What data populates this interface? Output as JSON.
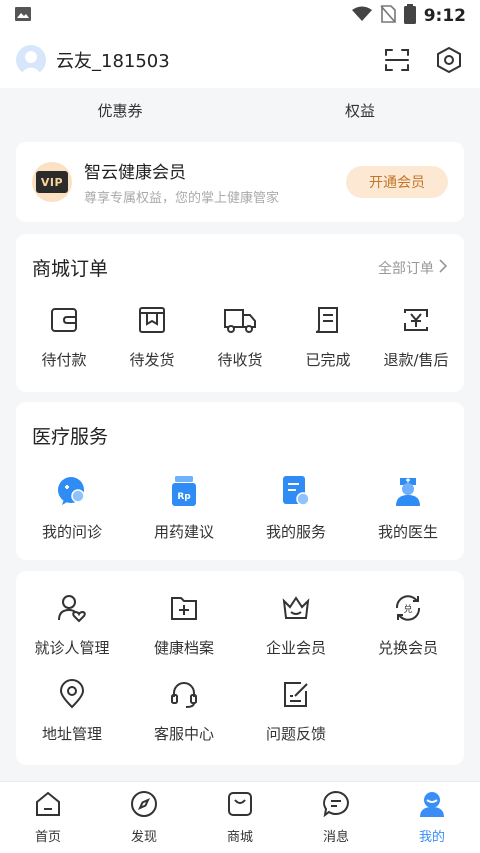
{
  "status_bar": {
    "time": "9:12"
  },
  "header": {
    "username": "云友_181503"
  },
  "coupon_row": {
    "coupon": "优惠券",
    "rights": "权益"
  },
  "vip": {
    "badge_text": "VIP",
    "title": "智云健康会员",
    "subtitle": "尊享专属权益，您的掌上健康管家",
    "button": "开通会员"
  },
  "orders": {
    "title": "商城订单",
    "all_link": "全部订单",
    "items": [
      {
        "label": "待付款",
        "icon": "wallet-icon"
      },
      {
        "label": "待发货",
        "icon": "package-icon"
      },
      {
        "label": "待收货",
        "icon": "truck-icon"
      },
      {
        "label": "已完成",
        "icon": "receipt-icon"
      },
      {
        "label": "退款/售后",
        "icon": "refund-icon"
      }
    ]
  },
  "medical": {
    "title": "医疗服务",
    "items": [
      {
        "label": "我的问诊",
        "icon": "chat-bubble-icon"
      },
      {
        "label": "用药建议",
        "icon": "medicine-bottle-icon"
      },
      {
        "label": "我的服务",
        "icon": "service-document-icon"
      },
      {
        "label": "我的医生",
        "icon": "nurse-icon"
      }
    ]
  },
  "more": {
    "items": [
      {
        "label": "就诊人管理",
        "icon": "patient-icon"
      },
      {
        "label": "健康档案",
        "icon": "folder-plus-icon"
      },
      {
        "label": "企业会员",
        "icon": "crown-icon"
      },
      {
        "label": "兑换会员",
        "icon": "exchange-icon"
      },
      {
        "label": "地址管理",
        "icon": "location-pin-icon"
      },
      {
        "label": "客服中心",
        "icon": "headset-icon"
      },
      {
        "label": "问题反馈",
        "icon": "feedback-edit-icon"
      }
    ]
  },
  "tabbar": {
    "items": [
      {
        "label": "首页",
        "icon": "home-icon",
        "active": false
      },
      {
        "label": "发现",
        "icon": "compass-icon",
        "active": false
      },
      {
        "label": "商城",
        "icon": "shopping-bag-icon",
        "active": false
      },
      {
        "label": "消息",
        "icon": "message-icon",
        "active": false
      },
      {
        "label": "我的",
        "icon": "profile-icon",
        "active": true
      }
    ]
  },
  "colors": {
    "accent": "#3a8ef6",
    "vip_button_bg": "#fde9d3",
    "vip_button_text": "#c0762b",
    "background": "#f5f6f8"
  }
}
